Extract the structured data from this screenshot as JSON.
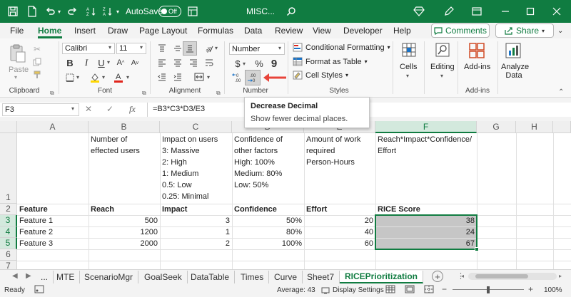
{
  "titlebar": {
    "autosave_label": "AutoSave",
    "autosave_state": "Off",
    "filename": "MISC..."
  },
  "tabs": [
    "File",
    "Home",
    "Insert",
    "Draw",
    "Page Layout",
    "Formulas",
    "Data",
    "Review",
    "View",
    "Developer",
    "Help"
  ],
  "active_tab": "Home",
  "comments_label": "Comments",
  "share_label": "Share",
  "ribbon": {
    "clipboard": {
      "paste_label": "Paste",
      "group_label": "Clipboard"
    },
    "font": {
      "name": "Calibri",
      "size": "11",
      "group_label": "Font"
    },
    "alignment": {
      "group_label": "Alignment"
    },
    "number": {
      "format": "Number",
      "group_label": "Number"
    },
    "styles": {
      "conditional": "Conditional Formatting",
      "format_table": "Format as Table",
      "cell_styles": "Cell Styles",
      "group_label": "Styles"
    },
    "cells": {
      "label": "Cells"
    },
    "editing": {
      "label": "Editing"
    },
    "addins": {
      "button_label": "Add-ins",
      "group_label": "Add-ins"
    },
    "analyze": {
      "label_line1": "Analyze",
      "label_line2": "Data"
    }
  },
  "tooltip": {
    "title": "Decrease Decimal",
    "desc": "Show fewer decimal places."
  },
  "formula_bar": {
    "name_box": "F3",
    "fx": "fx",
    "formula": "=B3*C3*D3/E3"
  },
  "columns": [
    "A",
    "B",
    "C",
    "D",
    "E",
    "F",
    "G",
    "H"
  ],
  "selected_column": "F",
  "rows": [
    "1",
    "2",
    "3",
    "4",
    "5",
    "6",
    "7"
  ],
  "selected_rows": [
    "3",
    "4",
    "5"
  ],
  "row1": {
    "B": [
      "Number of",
      "effected users"
    ],
    "C": [
      "Impact on users",
      "3: Massive",
      "2: High",
      "1: Medium",
      "0.5: Low",
      "0.25: Minimal"
    ],
    "D": [
      "Confidence of",
      "other factors",
      "High: 100%",
      "Medium: 80%",
      "Low: 50%"
    ],
    "E": [
      "Amount of work",
      "required",
      "Person-Hours"
    ],
    "F": [
      "Reach*Impact*Confidence/",
      "Effort"
    ]
  },
  "headers": {
    "A": "Feature",
    "B": "Reach",
    "C": "Impact",
    "D": "Confidence",
    "E": "Effort",
    "F": "RICE Score"
  },
  "table": [
    {
      "feature": "Feature 1",
      "reach": "500",
      "impact": "3",
      "confidence": "50%",
      "effort": "20",
      "rice": "38"
    },
    {
      "feature": "Feature 2",
      "reach": "1200",
      "impact": "1",
      "confidence": "80%",
      "effort": "40",
      "rice": "24"
    },
    {
      "feature": "Feature 3",
      "reach": "2000",
      "impact": "2",
      "confidence": "100%",
      "effort": "60",
      "rice": "67"
    }
  ],
  "sheet_tabs": [
    "...",
    "MTE",
    "ScenarioMgr",
    "GoalSeek",
    "DataTable",
    "Times",
    "Curve",
    "Sheet7",
    "RICEPrioritization"
  ],
  "active_sheet": "RICEPrioritization",
  "status": {
    "ready": "Ready",
    "average": "Average: 43",
    "display_settings": "Display Settings",
    "zoom": "100%"
  },
  "colors": {
    "accent": "#107c41",
    "selection_fill": "#c6c6c6",
    "annotation_arrow": "#e8443a"
  }
}
